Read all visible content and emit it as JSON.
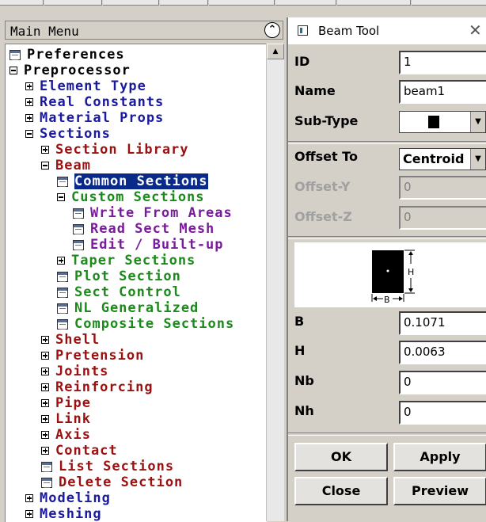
{
  "main_menu": {
    "title": "Main Menu",
    "tree": [
      {
        "label": "Preferences",
        "icon": "command-icon",
        "expander": "none",
        "color": "black",
        "indent": 0
      },
      {
        "label": "Preprocessor",
        "icon": "minus-icon",
        "expander": "minus",
        "color": "black",
        "indent": 0
      },
      {
        "label": "Element Type",
        "icon": "plus-icon",
        "expander": "plus",
        "color": "navy",
        "indent": 1
      },
      {
        "label": "Real Constants",
        "icon": "plus-icon",
        "expander": "plus",
        "color": "navy",
        "indent": 1
      },
      {
        "label": "Material Props",
        "icon": "plus-icon",
        "expander": "plus",
        "color": "navy",
        "indent": 1
      },
      {
        "label": "Sections",
        "icon": "minus-icon",
        "expander": "minus",
        "color": "navy",
        "indent": 1
      },
      {
        "label": "Section Library",
        "icon": "plus-icon",
        "expander": "plus",
        "color": "maroon",
        "indent": 2
      },
      {
        "label": "Beam",
        "icon": "minus-icon",
        "expander": "minus",
        "color": "maroon",
        "indent": 2
      },
      {
        "label": "Common Sections",
        "icon": "command-icon",
        "expander": "none",
        "color": "green",
        "indent": 3,
        "selected": true
      },
      {
        "label": "Custom Sections",
        "icon": "minus-icon",
        "expander": "minus",
        "color": "green",
        "indent": 3
      },
      {
        "label": "Write From Areas",
        "icon": "command-icon",
        "expander": "none",
        "color": "purple",
        "indent": 4
      },
      {
        "label": "Read Sect Mesh",
        "icon": "command-icon",
        "expander": "none",
        "color": "purple",
        "indent": 4
      },
      {
        "label": "Edit / Built-up",
        "icon": "command-icon",
        "expander": "none",
        "color": "purple",
        "indent": 4
      },
      {
        "label": "Taper Sections",
        "icon": "plus-icon",
        "expander": "plus",
        "color": "green",
        "indent": 3
      },
      {
        "label": "Plot Section",
        "icon": "command-icon",
        "expander": "none",
        "color": "green",
        "indent": 3
      },
      {
        "label": "Sect Control",
        "icon": "command-icon",
        "expander": "none",
        "color": "green",
        "indent": 3
      },
      {
        "label": "NL Generalized",
        "icon": "command-icon",
        "expander": "none",
        "color": "green",
        "indent": 3
      },
      {
        "label": "Composite Sections",
        "icon": "command-icon",
        "expander": "none",
        "color": "green",
        "indent": 3
      },
      {
        "label": "Shell",
        "icon": "plus-icon",
        "expander": "plus",
        "color": "maroon",
        "indent": 2
      },
      {
        "label": "Pretension",
        "icon": "plus-icon",
        "expander": "plus",
        "color": "maroon",
        "indent": 2
      },
      {
        "label": "Joints",
        "icon": "plus-icon",
        "expander": "plus",
        "color": "maroon",
        "indent": 2
      },
      {
        "label": "Reinforcing",
        "icon": "plus-icon",
        "expander": "plus",
        "color": "maroon",
        "indent": 2
      },
      {
        "label": "Pipe",
        "icon": "plus-icon",
        "expander": "plus",
        "color": "maroon",
        "indent": 2
      },
      {
        "label": "Link",
        "icon": "plus-icon",
        "expander": "plus",
        "color": "maroon",
        "indent": 2
      },
      {
        "label": "Axis",
        "icon": "plus-icon",
        "expander": "plus",
        "color": "maroon",
        "indent": 2
      },
      {
        "label": "Contact",
        "icon": "plus-icon",
        "expander": "plus",
        "color": "maroon",
        "indent": 2
      },
      {
        "label": "List Sections",
        "icon": "command-icon",
        "expander": "none",
        "color": "maroon",
        "indent": 2
      },
      {
        "label": "Delete Section",
        "icon": "command-icon",
        "expander": "none",
        "color": "maroon",
        "indent": 2
      },
      {
        "label": "Modeling",
        "icon": "plus-icon",
        "expander": "plus",
        "color": "navy",
        "indent": 1
      },
      {
        "label": "Meshing",
        "icon": "plus-icon",
        "expander": "plus",
        "color": "navy",
        "indent": 1
      }
    ]
  },
  "beam_tool": {
    "title": "Beam Tool",
    "id_label": "ID",
    "id_value": "1",
    "name_label": "Name",
    "name_value": "beam1",
    "subtype_label": "Sub-Type",
    "offset_label": "Offset To",
    "offset_value": "Centroid",
    "offset_y_label": "Offset-Y",
    "offset_y_value": "0",
    "offset_z_label": "Offset-Z",
    "offset_z_value": "0",
    "diagram_h": "H",
    "diagram_b": "B",
    "b_label": "B",
    "b_value": "0.1071",
    "h_label": "H",
    "h_value": "0.0063",
    "nb_label": "Nb",
    "nb_value": "0",
    "nh_label": "Nh",
    "nh_value": "0",
    "buttons": {
      "ok": "OK",
      "apply": "Apply",
      "close": "Close",
      "preview": "Preview"
    }
  },
  "colors": {
    "black": "#000000",
    "navy": "#1a1a9c",
    "maroon": "#9c1010",
    "green": "#1b8a1b",
    "purple": "#7a1a9c",
    "selection": "#0a2a8a"
  }
}
